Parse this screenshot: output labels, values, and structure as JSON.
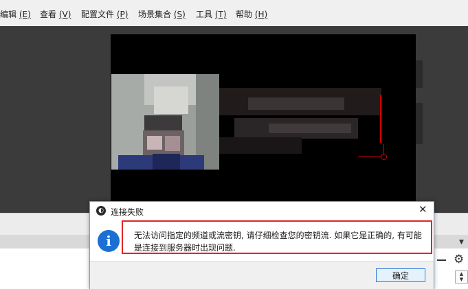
{
  "menubar": {
    "items": [
      {
        "label": "编辑",
        "key": "(E)"
      },
      {
        "label": "查看",
        "key": "(V)"
      },
      {
        "label": "配置文件",
        "key": "(P)"
      },
      {
        "label": "场景集合",
        "key": "(S)"
      },
      {
        "label": "工具",
        "key": "(T)"
      },
      {
        "label": "帮助",
        "key": "(H)"
      }
    ]
  },
  "dialog": {
    "title_icon": "obs-logo-icon",
    "title": "连接失败",
    "close": "✕",
    "message": "无法访问指定的频道或流密钥, 请仔细检查您的密钥流. 如果它是正确的, 有可能是连接到服务器时出现问题.",
    "ok_label": "确定",
    "info_glyph": "i"
  },
  "colors": {
    "highlight_border": "#e0242a",
    "info_blue": "#1c6fd3",
    "ok_border": "#2c7ad6"
  }
}
